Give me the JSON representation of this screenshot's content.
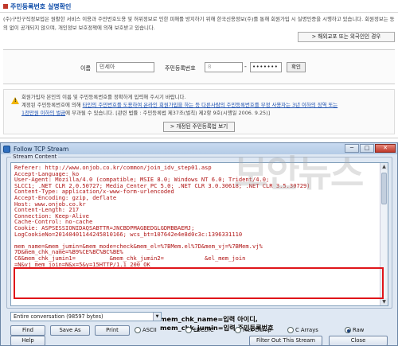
{
  "webpage": {
    "title": "주민등록번호 실명확인",
    "description": "(주)구인구직정보업은 원활한 서비스 이용과 주민번호도용 및 허위정보로 인한 피해를 방지하기 위해 한국신용정보(주)를 통해 회원가입 시 실명인증을 시행하고 있습니다. 회원정보는 동의 없이 공개되지 않으며, 개인정보 보호정책에 의해 보호받고 있습니다.",
    "foreigner_button": "> 해외교포 또는 외국인인 경우",
    "name_label": "이름",
    "name_value": "민세아",
    "rrn_label": "주민등록번호",
    "rrn_first": "8",
    "rrn_dash": "-",
    "rrn_second": "•••••••",
    "confirm_button": "확인",
    "notice_line1": "회원가입자 본인의 이름 및 주민등록번호를 정확하게 입력해 주시기 바랍니다.",
    "notice_line2_prefix": "계정된 주민등록번호에 의해 ",
    "notice_line2_link": "타인의 주민번호를 도용하여 온라인 회원가입을 하는 등 다른사람의 주민등록번호를 부정 사용자는 3년 이하의 징역 또는",
    "notice_line3_link": "1천만원 이하의 벌금",
    "notice_line3_suffix": "에 부과될 수 있습니다. [관련 법률 : 주민등록법 제37조(벌칙) 제2항 9호(시행일 2006. 9.25)]",
    "guide_button": "> 개정된 주민등록법 보기"
  },
  "dialog": {
    "title": "Follow TCP Stream",
    "min_button": "─",
    "max_button": "□",
    "close_button": "✕",
    "group_label": "Stream Content",
    "stream_lines": [
      "Referer: http://www.onjob.co.kr/common/join_idv_step01.asp",
      "Accept-Language: ko",
      "User-Agent: Mozilla/4.0 (compatible; MSIE 8.0; Windows NT 6.0; Trident/4.0;",
      "SLCC1; .NET CLR 2.0.50727; Media Center PC 5.0; .NET CLR 3.0.30618; .NET CLR 3.5.30729)",
      "Content-Type: application/x-www-form-urlencoded",
      "Accept-Encoding: gzip, deflate",
      "Host: www.onjob.co.kr",
      "Content-Length: 217",
      "Connection: Keep-Alive",
      "Cache-Control: no-cache",
      "Cookie: ASPSESSIONIDAQSABTTR=JNCBDPMAGBEDGLGDMBBAEMJ;",
      "LogCookieNo=20140401144245810166; wcs_bt=107642e4e8d0c3c:1396331110",
      "",
      "mem_name=&mem_jumin=&mem_mode=check&mem_el=%7BMem.el%7D&mem_vj=%7BMem.vj%",
      "7D&mem_chk_name=%B9%CE%BC%BC%BE%",
      "C6&mem_chk_jumin1=          &mem_chk_jumin2=            &el_mem_join",
      "=N&vj_mem_join=N&x=5&y=15HTTP/1.1 200 OK"
    ],
    "annotation_line1": "mem_chk_name=입력 아이디,",
    "annotation_line2": "mem_chk_jumin=입력 주민등록번호",
    "conversation_select": "Entire conversation (98597 bytes)",
    "buttons": {
      "find": "Find",
      "save_as": "Save As",
      "print": "Print",
      "help": "Help",
      "filter_out": "Filter Out This Stream",
      "close": "Close"
    },
    "radios": {
      "ascii": "ASCII",
      "ebcdic": "EBCDIC",
      "hex_dump": "Hex Dump",
      "c_arrays": "C Arrays",
      "raw": "Raw",
      "selected": "Raw"
    }
  },
  "watermark": "보안뉴스"
}
